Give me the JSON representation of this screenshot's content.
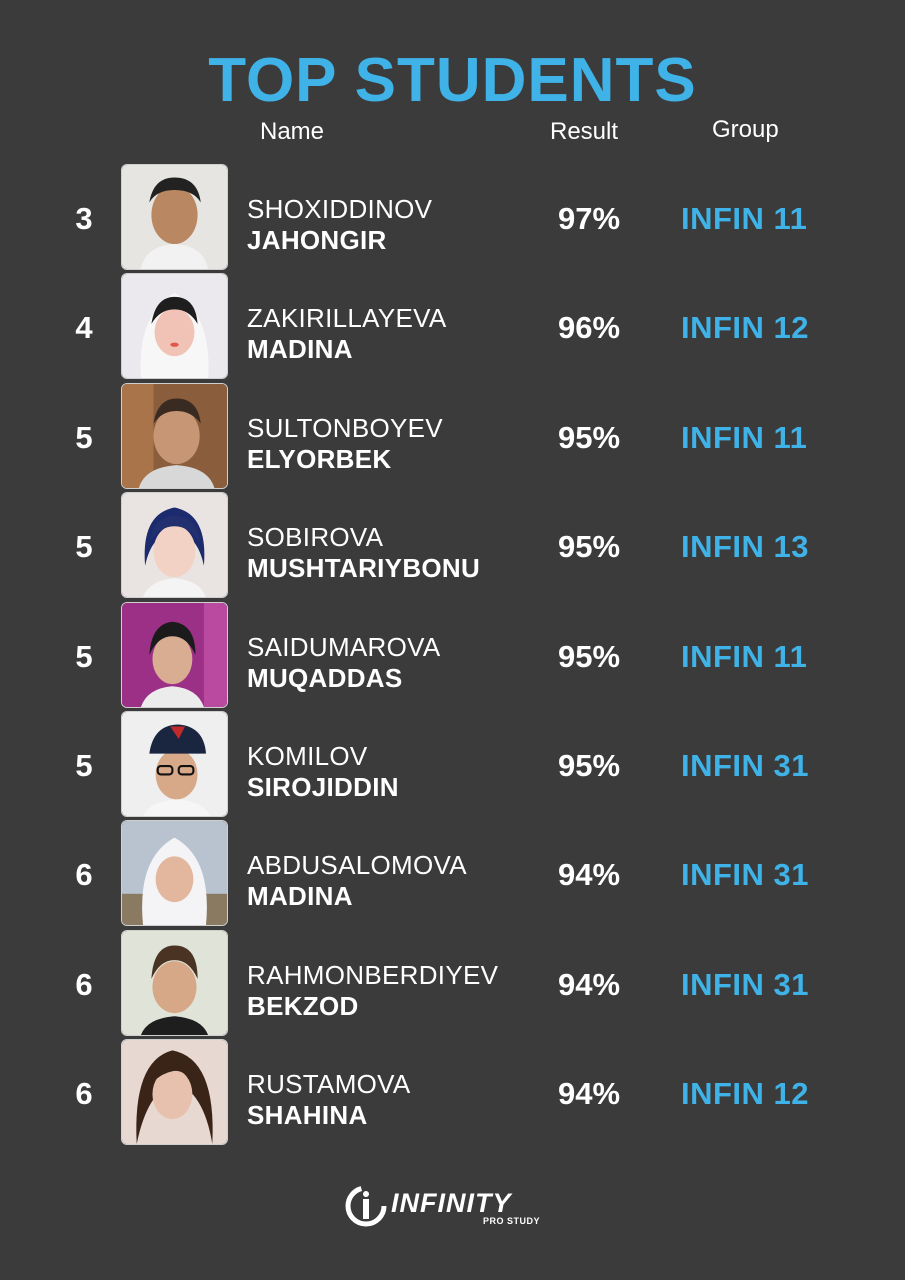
{
  "title": "TOP STUDENTS",
  "headers": {
    "name": "Name",
    "result": "Result",
    "group": "Group"
  },
  "accent_color": "#3fb3e8",
  "background_color": "#3b3b3b",
  "students": [
    {
      "rank": "3",
      "surname": "SHOXIDDINOV",
      "first_name": "JAHONGIR",
      "result": "97%",
      "group": "INFIN 11"
    },
    {
      "rank": "4",
      "surname": "ZAKIRILLAYEVA",
      "first_name": "MADINA",
      "result": "96%",
      "group": "INFIN 12"
    },
    {
      "rank": "5",
      "surname": "SULTONBOYEV",
      "first_name": "ELYORBEK",
      "result": "95%",
      "group": "INFIN 11"
    },
    {
      "rank": "5",
      "surname": "SOBIROVA",
      "first_name": "MUSHTARIYBONU",
      "result": "95%",
      "group": "INFIN 13"
    },
    {
      "rank": "5",
      "surname": "SAIDUMAROVA",
      "first_name": "MUQADDAS",
      "result": "95%",
      "group": "INFIN 11"
    },
    {
      "rank": "5",
      "surname": "KOMILOV",
      "first_name": "SIROJIDDIN",
      "result": "95%",
      "group": "INFIN 31"
    },
    {
      "rank": "6",
      "surname": "ABDUSALOMOVA",
      "first_name": "MADINA",
      "result": "94%",
      "group": "INFIN 31"
    },
    {
      "rank": "6",
      "surname": "RAHMONBERDIYEV",
      "first_name": "BEKZOD",
      "result": "94%",
      "group": "INFIN 31"
    },
    {
      "rank": "6",
      "surname": "RUSTAMOVA",
      "first_name": "SHAHINA",
      "result": "94%",
      "group": "INFIN 12"
    }
  ],
  "logo": {
    "name": "INFINITY",
    "tagline": "PRO STUDY"
  }
}
